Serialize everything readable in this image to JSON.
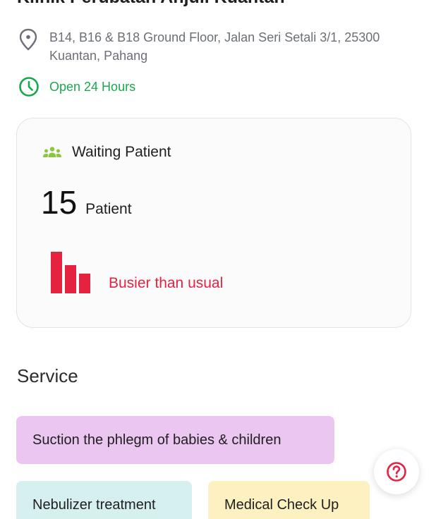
{
  "clinic": {
    "name": "Klinik Perubatan Anjuli Kuantan",
    "address": "B14, B16 & B18 Ground Floor, Jalan Seri Setali 3/1, 25300 Kuantan, Pahang",
    "hours": "Open 24 Hours"
  },
  "waiting": {
    "label": "Waiting Patient",
    "count": "15",
    "unit": "Patient",
    "status": "Busier than usual",
    "busyness_level": [
      0.92,
      0.62,
      0.44
    ]
  },
  "services": {
    "heading": "Service",
    "items": [
      {
        "label": "Suction the phlegm of babies & children",
        "color": "#eac6f1"
      },
      {
        "label": "Nebulizer treatment",
        "color": "#d6f0f0"
      },
      {
        "label": "Medical Check Up",
        "color": "#fdf1c1"
      }
    ]
  },
  "colors": {
    "busy": "#e52341",
    "open": "#1aa84c",
    "icon_waiting": "#8cc63f",
    "help": "#e52341"
  },
  "icons": {
    "address": "location-pin-icon",
    "hours": "clock-icon",
    "waiting": "people-group-icon",
    "busy": "bar-chart-icon",
    "help": "help-circle-icon"
  }
}
